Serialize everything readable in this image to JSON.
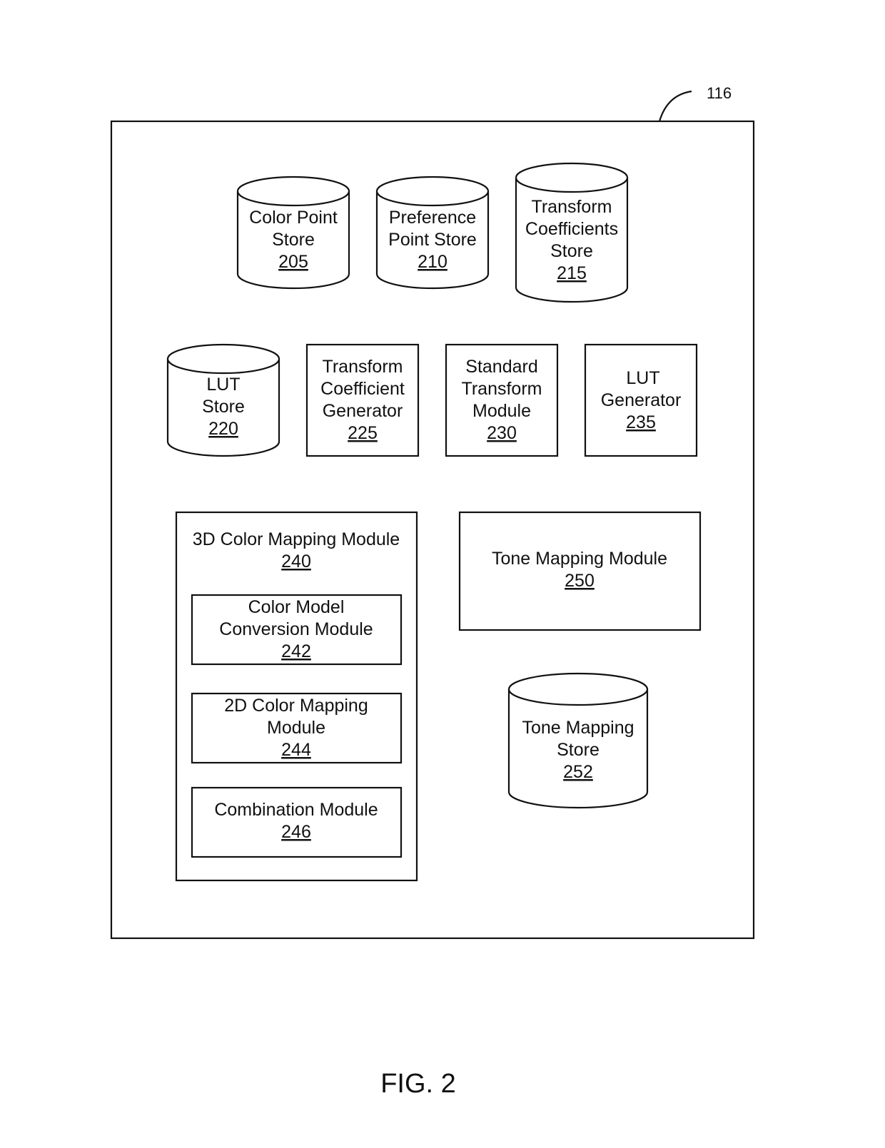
{
  "figure": {
    "caption": "FIG. 2",
    "reference_number": "116"
  },
  "components": {
    "color_point_store": {
      "lines": [
        "Color Point",
        "Store"
      ],
      "number": "205",
      "shape": "cylinder"
    },
    "preference_point_store": {
      "lines": [
        "Preference",
        "Point Store"
      ],
      "number": "210",
      "shape": "cylinder"
    },
    "transform_coefficients_store": {
      "lines": [
        "Transform",
        "Coefficients",
        "Store"
      ],
      "number": "215",
      "shape": "cylinder"
    },
    "lut_store": {
      "lines": [
        "LUT",
        "Store"
      ],
      "number": "220",
      "shape": "cylinder"
    },
    "transform_coefficient_generator": {
      "lines": [
        "Transform",
        "Coefficient",
        "Generator"
      ],
      "number": "225",
      "shape": "box"
    },
    "standard_transform_module": {
      "lines": [
        "Standard",
        "Transform",
        "Module"
      ],
      "number": "230",
      "shape": "box"
    },
    "lut_generator": {
      "lines": [
        "LUT",
        "Generator"
      ],
      "number": "235",
      "shape": "box"
    },
    "color_mapping_3d_module": {
      "lines": [
        "3D Color Mapping Module"
      ],
      "number": "240",
      "shape": "box"
    },
    "color_model_conversion_module": {
      "lines": [
        "Color Model",
        "Conversion Module"
      ],
      "number": "242",
      "shape": "box"
    },
    "color_mapping_2d_module": {
      "lines": [
        "2D Color Mapping",
        "Module"
      ],
      "number": "244",
      "shape": "box"
    },
    "combination_module": {
      "lines": [
        "Combination Module"
      ],
      "number": "246",
      "shape": "box"
    },
    "tone_mapping_module": {
      "lines": [
        "Tone Mapping Module"
      ],
      "number": "250",
      "shape": "box"
    },
    "tone_mapping_store": {
      "lines": [
        "Tone Mapping",
        "Store"
      ],
      "number": "252",
      "shape": "cylinder"
    }
  }
}
